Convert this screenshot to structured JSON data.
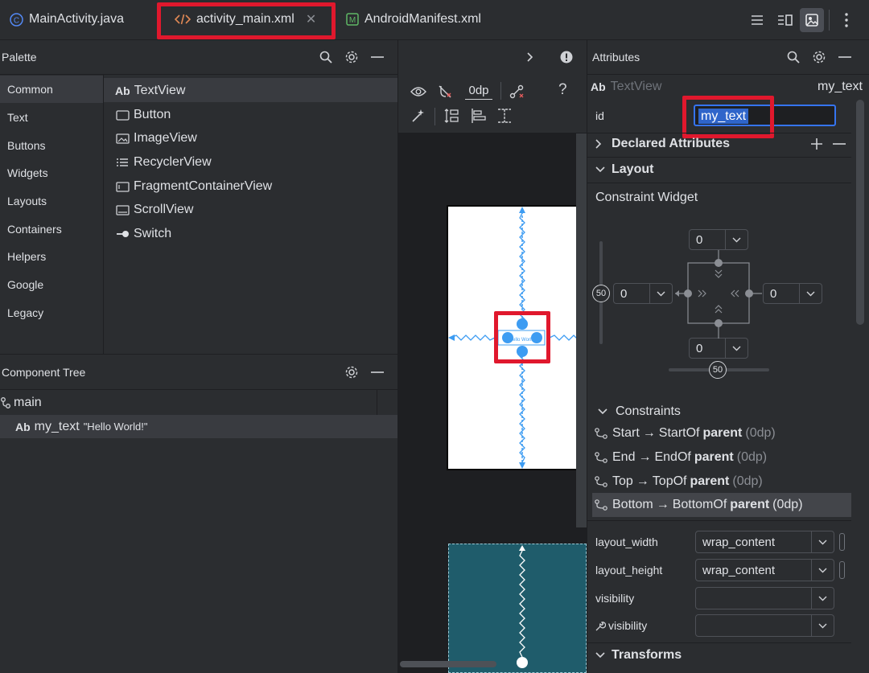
{
  "tabs": [
    {
      "label": "MainActivity.java",
      "icon": "class-icon"
    },
    {
      "label": "activity_main.xml",
      "icon": "xml-icon",
      "active": true
    },
    {
      "label": "AndroidManifest.xml",
      "icon": "manifest-icon"
    }
  ],
  "palette": {
    "title": "Palette",
    "categories": [
      "Common",
      "Text",
      "Buttons",
      "Widgets",
      "Layouts",
      "Containers",
      "Helpers",
      "Google",
      "Legacy"
    ],
    "selected_category": "Common",
    "items": [
      {
        "label": "TextView",
        "icon": "textview-icon",
        "prefix": "Ab"
      },
      {
        "label": "Button",
        "icon": "button-icon"
      },
      {
        "label": "ImageView",
        "icon": "imageview-icon"
      },
      {
        "label": "RecyclerView",
        "icon": "recyclerview-icon"
      },
      {
        "label": "FragmentContainerView",
        "icon": "fragment-icon"
      },
      {
        "label": "ScrollView",
        "icon": "scrollview-icon"
      },
      {
        "label": "Switch",
        "icon": "switch-icon"
      }
    ]
  },
  "tree": {
    "title": "Component Tree",
    "root": "main",
    "child_prefix": "Ab",
    "child_name": "my_text",
    "child_text": "\"Hello World!\""
  },
  "design_toolbar": {
    "margin_value": "0dp",
    "help": "?"
  },
  "attributes": {
    "title": "Attributes",
    "component_prefix": "Ab",
    "component_type": "TextView",
    "component_id": "my_text",
    "id_label": "id",
    "id_value": "my_text",
    "declared_attributes": "Declared Attributes",
    "layout_section": "Layout",
    "constraint_widget": "Constraint Widget",
    "margins": {
      "top": "0",
      "start": "0",
      "end": "0",
      "bottom": "0"
    },
    "bias": {
      "vertical": "50",
      "horizontal": "50"
    },
    "constraints_section": "Constraints",
    "constraints": [
      {
        "side": "Start",
        "arrow": "→",
        "target_side": "StartOf",
        "target": "parent",
        "margin": "(0dp)"
      },
      {
        "side": "End",
        "arrow": "→",
        "target_side": "EndOf",
        "target": "parent",
        "margin": "(0dp)"
      },
      {
        "side": "Top",
        "arrow": "→",
        "target_side": "TopOf",
        "target": "parent",
        "margin": "(0dp)"
      },
      {
        "side": "Bottom",
        "arrow": "→",
        "target_side": "BottomOf",
        "target": "parent",
        "margin": "(0dp)",
        "selected": true
      }
    ],
    "layout_width_label": "layout_width",
    "layout_width_value": "wrap_content",
    "layout_height_label": "layout_height",
    "layout_height_value": "wrap_content",
    "visibility_label": "visibility",
    "visibility_value": "",
    "tools_visibility_label": "visibility",
    "tools_visibility_value": "",
    "transforms_section": "Transforms"
  },
  "colors": {
    "accent": "#3574f0",
    "highlight": "#e0182d",
    "constraint": "#3d9cf2",
    "blueprint": "#1f5c6b",
    "background": "#2b2d30"
  }
}
